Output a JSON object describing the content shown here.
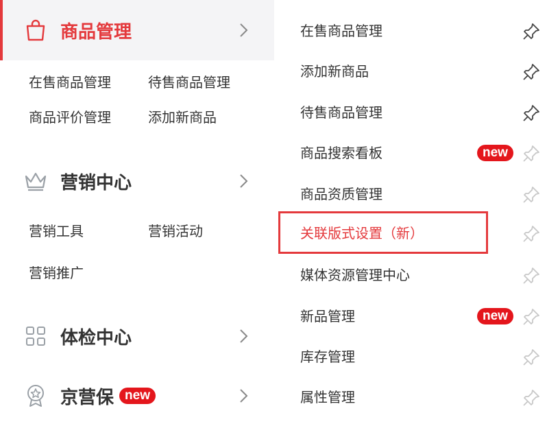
{
  "left": {
    "sections": [
      {
        "title": "商品管理",
        "icon": "shopping-bag-icon",
        "active": true,
        "badge": "",
        "items": [
          "在售商品管理",
          "待售商品管理",
          "商品评价管理",
          "添加新商品"
        ]
      },
      {
        "title": "营销中心",
        "icon": "crown-icon",
        "active": false,
        "badge": "",
        "items": [
          "营销工具",
          "营销活动",
          "营销推广"
        ]
      },
      {
        "title": "体检中心",
        "icon": "grid-apps-icon",
        "active": false,
        "badge": "",
        "items": []
      },
      {
        "title": "京营保",
        "icon": "medal-icon",
        "active": false,
        "badge": "new",
        "items": []
      }
    ]
  },
  "right": {
    "items": [
      {
        "label": "在售商品管理",
        "badge": "",
        "pinned": true,
        "highlight": false
      },
      {
        "label": "添加新商品",
        "badge": "",
        "pinned": true,
        "highlight": false
      },
      {
        "label": "待售商品管理",
        "badge": "",
        "pinned": true,
        "highlight": false
      },
      {
        "label": "商品搜索看板",
        "badge": "new",
        "pinned": false,
        "highlight": false
      },
      {
        "label": "商品资质管理",
        "badge": "",
        "pinned": false,
        "highlight": false
      },
      {
        "label": "关联版式设置（新）",
        "badge": "",
        "pinned": false,
        "highlight": true
      },
      {
        "label": "媒体资源管理中心",
        "badge": "",
        "pinned": false,
        "highlight": false
      },
      {
        "label": "新品管理",
        "badge": "new",
        "pinned": false,
        "highlight": false
      },
      {
        "label": "库存管理",
        "badge": "",
        "pinned": false,
        "highlight": false
      },
      {
        "label": "属性管理",
        "badge": "",
        "pinned": false,
        "highlight": false
      }
    ]
  },
  "colors": {
    "accent": "#e4393c",
    "badge": "#e4161c",
    "pin_active": "#444444",
    "pin_inactive": "#c8c8c8",
    "icon_gray": "#9aa0a6"
  }
}
